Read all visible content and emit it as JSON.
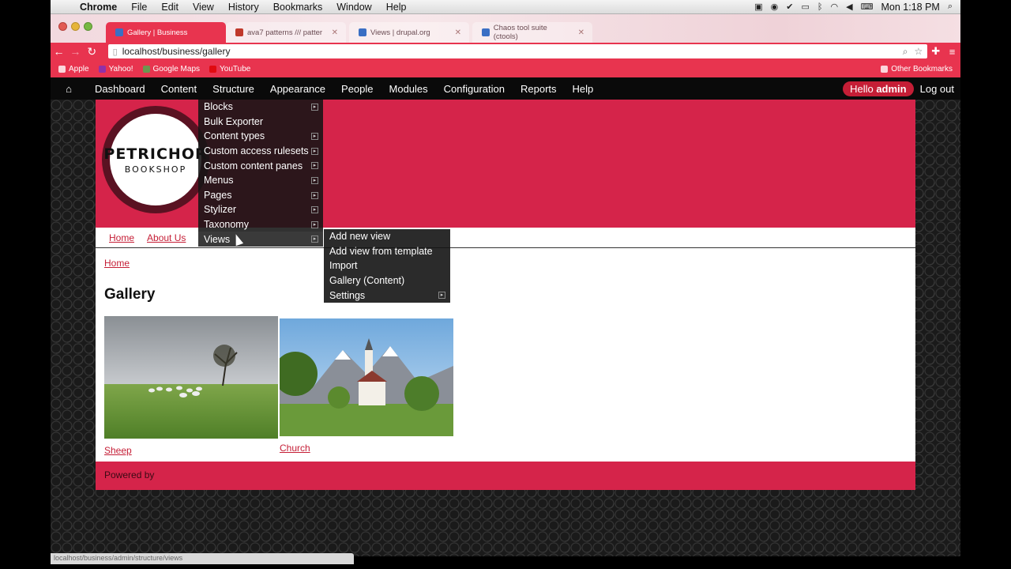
{
  "macbar": {
    "app": "Chrome",
    "menus": [
      "File",
      "Edit",
      "View",
      "History",
      "Bookmarks",
      "Window",
      "Help"
    ],
    "clock": "Mon 1:18 PM"
  },
  "tabs": [
    {
      "label": "Gallery | Business"
    },
    {
      "label": "ava7 patterns /// patter"
    },
    {
      "label": "Views | drupal.org"
    },
    {
      "label": "Chaos tool suite (ctools)"
    }
  ],
  "url": "localhost/business/gallery",
  "bookmarks": {
    "items": [
      "Apple",
      "Yahoo!",
      "Google Maps",
      "YouTube"
    ],
    "other": "Other Bookmarks"
  },
  "admin": {
    "items": [
      "Dashboard",
      "Content",
      "Structure",
      "Appearance",
      "People",
      "Modules",
      "Configuration",
      "Reports",
      "Help"
    ],
    "hello_prefix": "Hello",
    "hello_user": "admin",
    "logout": "Log out"
  },
  "site": {
    "logo_line1": "PETRICHOR",
    "logo_line2": "BOOKSHOP",
    "nav": [
      "Home",
      "About Us"
    ],
    "breadcrumb": "Home",
    "title": "Gallery",
    "items": [
      {
        "caption": "Sheep"
      },
      {
        "caption": "Church"
      }
    ],
    "footer": "Powered by"
  },
  "structure_menu": [
    "Blocks",
    "Bulk Exporter",
    "Content types",
    "Custom access rulesets",
    "Custom content panes",
    "Menus",
    "Pages",
    "Stylizer",
    "Taxonomy",
    "Views"
  ],
  "views_submenu": [
    "Add new view",
    "Add view from template",
    "Import",
    "Gallery (Content)",
    "Settings"
  ],
  "status_url": "localhost/business/admin/structure/views",
  "colors": {
    "accent": "#d5244a",
    "link": "#c51e36",
    "admin_bar": "#0a0a0a"
  }
}
